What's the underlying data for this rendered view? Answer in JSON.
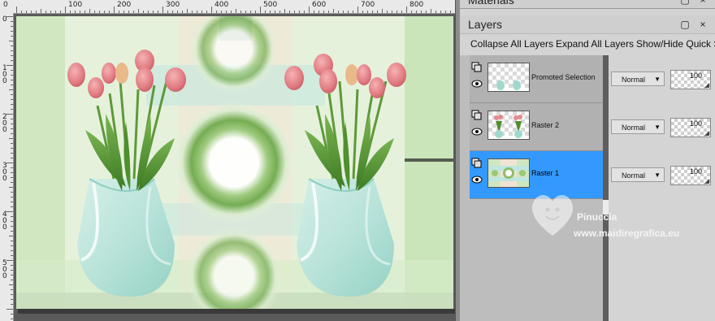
{
  "canvas": {
    "ruler_top_labels": [
      "0",
      "100",
      "200",
      "300",
      "400",
      "500",
      "600",
      "700",
      "800"
    ],
    "ruler_left_labels": [
      "0",
      "100",
      "200",
      "300",
      "400",
      "500"
    ]
  },
  "panels": {
    "materials": {
      "title": "Materials",
      "pin_icon": "pin-icon",
      "close_label": "×"
    },
    "layers": {
      "title": "Layers",
      "pin_icon": "pin-icon",
      "close_label": "×",
      "toolbar": {
        "collapse_all": "Collapse All Layers",
        "expand_all": "Expand All Layers",
        "show_hide_quick": "Show/Hide Quick S"
      },
      "rows": [
        {
          "name": "Promoted Selection",
          "blend_mode": "Normal",
          "opacity": "100",
          "selected": false
        },
        {
          "name": "Raster 2",
          "blend_mode": "Normal",
          "opacity": "100",
          "selected": false
        },
        {
          "name": "Raster 1",
          "blend_mode": "Normal",
          "opacity": "100",
          "selected": true
        }
      ]
    }
  },
  "watermark": {
    "name": "Pinuccia",
    "site": "www.maidiregrafica.eu"
  },
  "colors": {
    "selection": "#3399ff",
    "panel_bg": "#d4d4d4",
    "list_bg": "#bdbdbd",
    "tulip_pink": "#e58a8e",
    "vase_aqua": "#bfe6de",
    "leaf_green": "#4f8f2e"
  }
}
